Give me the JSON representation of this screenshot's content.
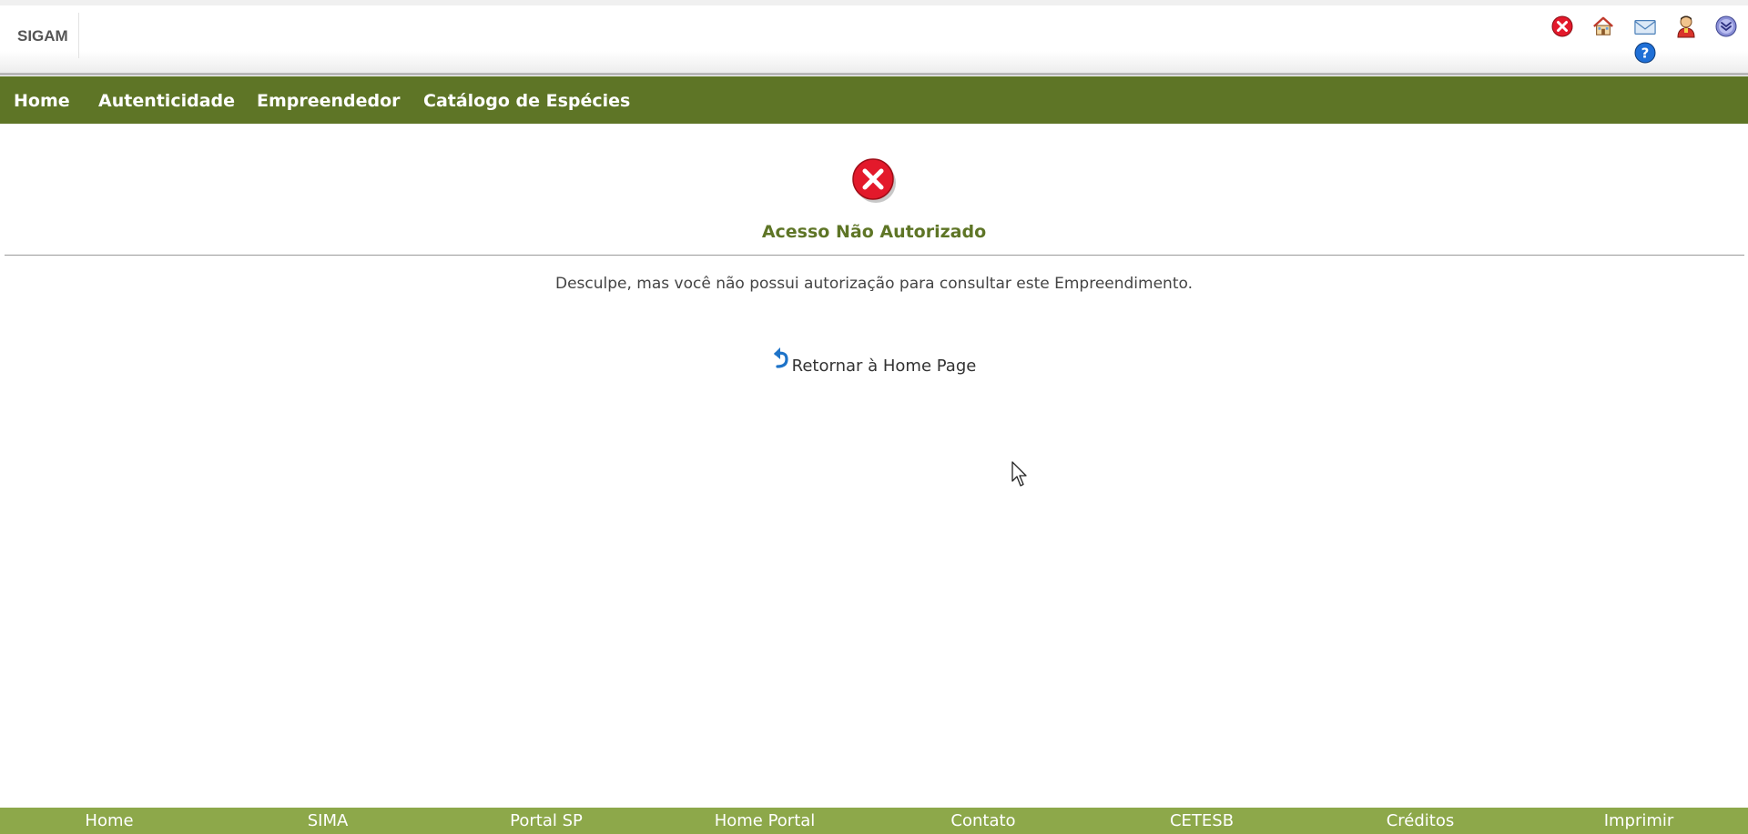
{
  "header": {
    "logo": "SIGAM",
    "icons": [
      "close-circle-icon",
      "home-icon",
      "mail-icon",
      "user-icon",
      "chevron-down-circle-icon",
      "help-icon"
    ]
  },
  "nav": {
    "items": [
      "Home",
      "Autenticidade",
      "Empreendedor",
      "Catálogo de Espécies"
    ]
  },
  "main": {
    "title": "Acesso Não Autorizado",
    "message": "Desculpe, mas você não possui autorização para consultar este Empreendimento.",
    "return_link": "Retornar à Home Page"
  },
  "footer": {
    "items": [
      "Home",
      "SIMA",
      "Portal SP",
      "Home Portal",
      "Contato",
      "CETESB",
      "Créditos",
      "Imprimir"
    ]
  },
  "colors": {
    "nav_bg": "#5e7526",
    "footer_bg": "#8da84a",
    "title": "#5e7526",
    "error": "#e3192b"
  }
}
